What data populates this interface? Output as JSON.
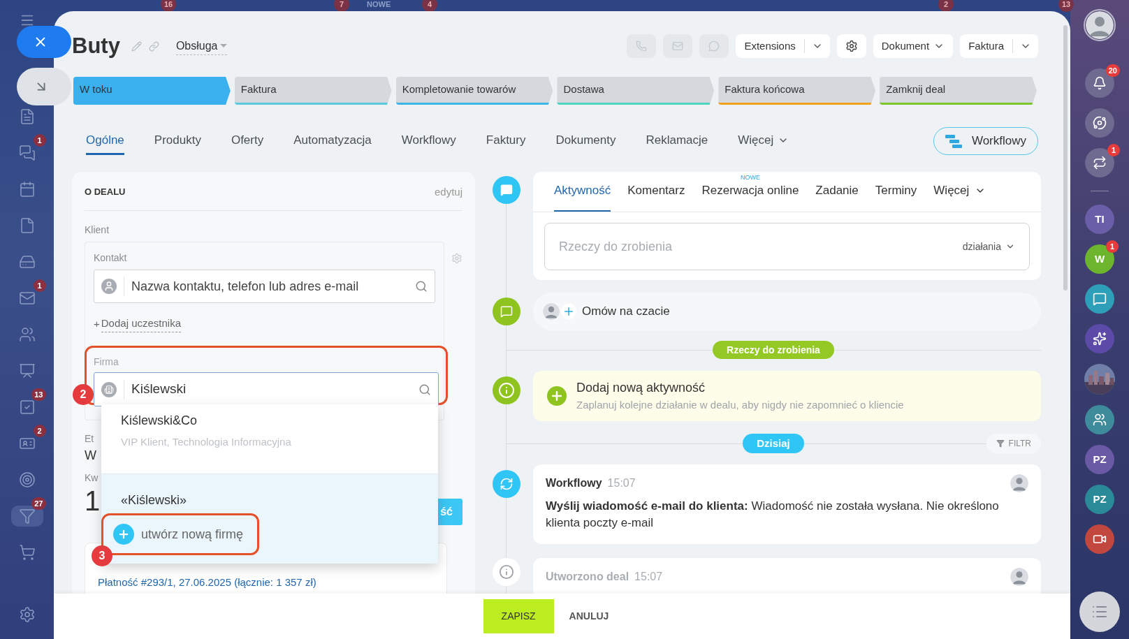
{
  "background_badges": [
    {
      "text": "16"
    },
    {
      "text": "7"
    },
    {
      "text": "NOWE",
      "kind": "label"
    },
    {
      "text": "4"
    },
    {
      "text": "2"
    },
    {
      "text": "13"
    }
  ],
  "left_sidebar": {
    "items": [
      {
        "selected": false
      },
      {
        "badge": "1",
        "selected": false
      },
      {
        "selected": false
      },
      {
        "selected": false
      },
      {
        "selected": false
      },
      {
        "badge": "1",
        "selected": false
      },
      {
        "selected": false
      },
      {
        "selected": false
      },
      {
        "badge": "13",
        "selected": false
      },
      {
        "badge": "2",
        "selected": false
      },
      {
        "selected": false
      },
      {
        "badge": "27",
        "selected": true
      },
      {
        "selected": false
      },
      {
        "selected": false
      }
    ]
  },
  "header": {
    "title": "Buty",
    "category": "Obsługa",
    "toolbar": [
      {
        "kind": "split",
        "label": "Extensions"
      },
      {
        "kind": "icon"
      },
      {
        "kind": "menu",
        "label": "Dokument"
      },
      {
        "kind": "split",
        "label": "Faktura"
      }
    ]
  },
  "stages": [
    {
      "label": "W toku",
      "color": "#3bb0ef",
      "selected": true
    },
    {
      "label": "Faktura",
      "color": "#5cc9df",
      "selected": false
    },
    {
      "label": "Kompletowanie towarów",
      "color": "#3cb4e6",
      "selected": false
    },
    {
      "label": "Dostawa",
      "color": "#4fd6c2",
      "selected": false
    },
    {
      "label": "Faktura końcowa",
      "color": "#f0a31a",
      "selected": false
    },
    {
      "label": "Zamknij deal",
      "color": "#7dc62c",
      "selected": false
    }
  ],
  "tabs": [
    {
      "label": "Ogólne",
      "selected": true
    },
    {
      "label": "Produkty",
      "selected": false
    },
    {
      "label": "Oferty",
      "selected": false
    },
    {
      "label": "Automatyzacja",
      "selected": false
    },
    {
      "label": "Workflowy",
      "selected": false
    },
    {
      "label": "Faktury",
      "selected": false
    },
    {
      "label": "Dokumenty",
      "selected": false
    },
    {
      "label": "Reklamacje",
      "selected": false
    },
    {
      "label": "Więcej",
      "selected": false,
      "kind": "more"
    }
  ],
  "workflow_button": "Workflowy",
  "deal_card": {
    "title": "O DEALU",
    "edit": "edytuj",
    "client_label": "Klient",
    "contact_label": "Kontakt",
    "contact_placeholder": "Nazwa kontaktu, telefon lub adres e-mail",
    "add_participant": {
      "plus": "+",
      "label": "Dodaj uczestnika"
    },
    "company": {
      "label": "Firma",
      "value": "Kiślewski",
      "callout": "2"
    },
    "hidden_fields": [
      {
        "label": "Et",
        "value": "W"
      },
      {
        "label": "Kw",
        "value": "1"
      }
    ],
    "covered_button": "ść",
    "payment_link": "Płatność #293/1, 27.06.2025 (łącznie: 1 357 zł)"
  },
  "company_dropdown": {
    "results": [
      {
        "name": "Kiślewski&Co",
        "description": "VIP Klient, Technologia Informacyjna"
      }
    ],
    "query": "«Kiślewski»",
    "create_action": "utwórz nową firmę",
    "callout": "3"
  },
  "timeline": {
    "composer_tabs": [
      {
        "label": "Aktywność",
        "selected": true,
        "kind": "tab"
      },
      {
        "label": "Komentarz",
        "selected": false,
        "kind": "tab"
      },
      {
        "label": "Rezerwacja online",
        "selected": false,
        "badge": "NOWE",
        "kind": "tab"
      },
      {
        "label": "Zadanie",
        "selected": false,
        "kind": "tab"
      },
      {
        "label": "Terminy",
        "selected": false,
        "kind": "tab"
      },
      {
        "label": "Więcej",
        "selected": false,
        "kind": "more"
      }
    ],
    "composer_placeholder": "Rzeczy do zrobienia",
    "composer_actions": "działania",
    "chat_prompt": "Omów na czacie",
    "todo_divider": "Rzeczy do zrobienia",
    "add_activity": {
      "title": "Dodaj nową aktywność",
      "subtitle": "Zaplanuj kolejne działanie w dealu, aby nigdy nie zapomnieć o kliencie"
    },
    "today_divider": "Dzisiaj",
    "filter": "FILTR",
    "entries": [
      {
        "title": "Workflowy",
        "time": "15:07",
        "body": "**Wyślij wiadomość e-mail do klienta:** Wiadomość nie została wysłana. Nie określono klienta poczty e-mail",
        "muted": false
      },
      {
        "title": "Utworzono deal",
        "time": "15:07",
        "muted": true
      }
    ]
  },
  "footer": {
    "save": "ZAPISZ",
    "cancel": "ANULUJ"
  },
  "right_sidebar": {
    "items": [
      {
        "kind": "avatar"
      },
      {
        "kind": "icon",
        "badge": "20"
      },
      {
        "kind": "icon"
      },
      {
        "kind": "icon",
        "badge": "1"
      },
      {
        "kind": "divider"
      },
      {
        "kind": "initials",
        "text": "TI",
        "color": "#6b5ea8"
      },
      {
        "kind": "initials",
        "text": "W",
        "color": "#6cb52d",
        "badge": "1"
      },
      {
        "kind": "icon"
      },
      {
        "kind": "icon"
      },
      {
        "kind": "picture"
      },
      {
        "kind": "icon"
      },
      {
        "kind": "initials",
        "text": "PZ",
        "color": "#6a5aa6"
      },
      {
        "kind": "initials",
        "text": "PZ",
        "color": "#2a8a98"
      },
      {
        "kind": "icon"
      }
    ]
  }
}
